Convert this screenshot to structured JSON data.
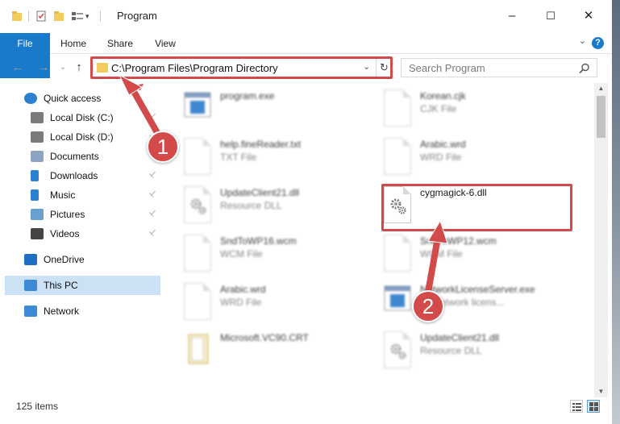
{
  "window": {
    "title": "Program",
    "controls": {
      "minimize": "–",
      "maximize": "☐",
      "close": "✕"
    }
  },
  "ribbon": {
    "tabs": [
      "File",
      "Home",
      "Share",
      "View"
    ],
    "collapse": "⌄",
    "help": "?"
  },
  "nav": {
    "back": "←",
    "forward": "→",
    "recent": "⌄",
    "up": "↑",
    "address": "C:\\Program Files\\Program Directory",
    "address_dropdown": "⌄",
    "refresh": "↻",
    "search_placeholder": "Search Program"
  },
  "sidebar": {
    "items": [
      {
        "label": "Quick access",
        "icon": "star-icon",
        "pinned": false
      },
      {
        "label": "Local Disk (C:)",
        "icon": "drive-icon",
        "pinned": true
      },
      {
        "label": "Local Disk (D:)",
        "icon": "drive-icon",
        "pinned": true
      },
      {
        "label": "Documents",
        "icon": "documents-icon",
        "pinned": true
      },
      {
        "label": "Downloads",
        "icon": "downloads-icon",
        "pinned": true
      },
      {
        "label": "Music",
        "icon": "music-icon",
        "pinned": true
      },
      {
        "label": "Pictures",
        "icon": "pictures-icon",
        "pinned": true
      },
      {
        "label": "Videos",
        "icon": "videos-icon",
        "pinned": true
      },
      {
        "label": "OneDrive",
        "icon": "onedrive-icon",
        "pinned": false
      },
      {
        "label": "This PC",
        "icon": "this-pc-icon",
        "pinned": false,
        "selected": true
      },
      {
        "label": "Network",
        "icon": "network-icon",
        "pinned": false
      }
    ],
    "pin_glyph": "📌"
  },
  "files": [
    {
      "name": "program.exe",
      "type": ""
    },
    {
      "name": "Korean.cjk",
      "type": "CJK File"
    },
    {
      "name": "help.fineReader.txt",
      "type": "TXT File"
    },
    {
      "name": "Arabic.wrd",
      "type": "WRD File"
    },
    {
      "name": "UpdateClient21.dll",
      "type": "Resource DLL"
    },
    {
      "name": "cygmagick-6.dll",
      "type": ""
    },
    {
      "name": "SndToWP16.wcm",
      "type": "WCM File"
    },
    {
      "name": "SndToWP12.wcm",
      "type": "WCM File"
    },
    {
      "name": "Arabic.wrd",
      "type": "WRD File"
    },
    {
      "name": "NetworkLicenseServer.exe",
      "type": "FY network licens..."
    },
    {
      "name": "Microsoft.VC90.CRT",
      "type": ""
    },
    {
      "name": "UpdateClient21.dll",
      "type": "Resource DLL"
    }
  ],
  "status": {
    "items_count": "125 items"
  },
  "callouts": {
    "step1": "1",
    "step2": "2"
  },
  "colors": {
    "accent": "#1979ca",
    "highlight": "#d34a4a",
    "selected": "#cce1f3"
  }
}
